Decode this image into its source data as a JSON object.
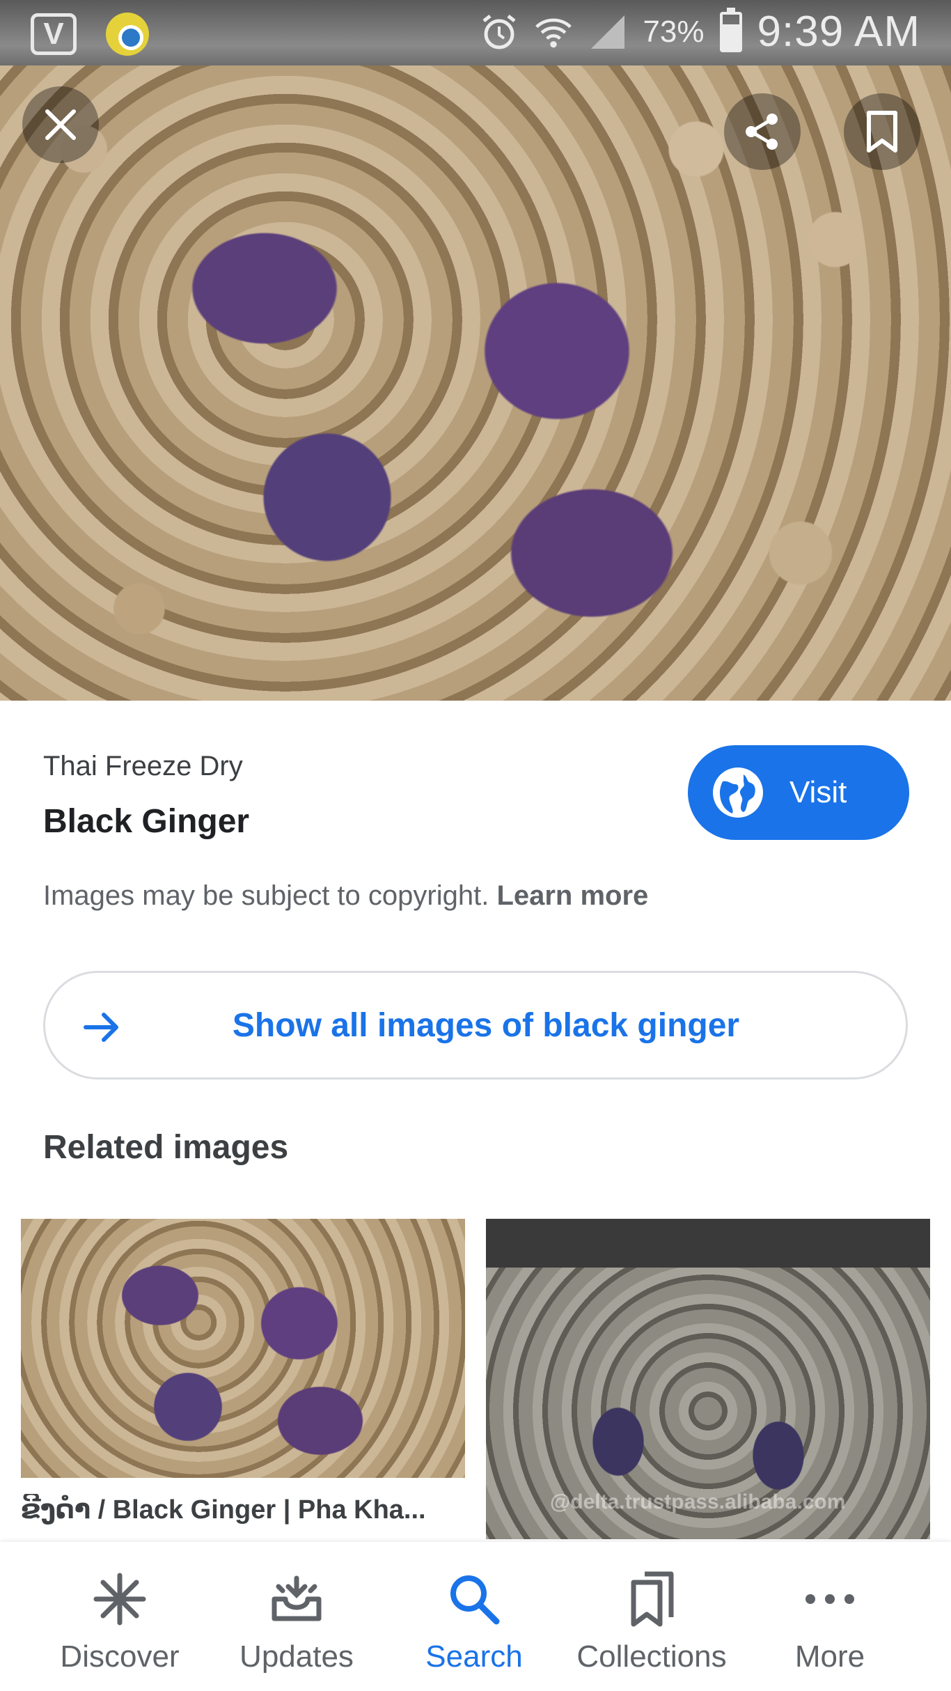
{
  "status_bar": {
    "battery_percent": "73%",
    "time": "9:39 AM"
  },
  "image_viewer": {
    "close_icon": "close-icon",
    "share_icon": "share-icon",
    "bookmark_icon": "bookmark-icon"
  },
  "result": {
    "source": "Thai Freeze Dry",
    "title": "Black Ginger",
    "visit_label": "Visit",
    "copyright_text": "Images may be subject to copyright.",
    "learn_more": "Learn more"
  },
  "show_all": {
    "label": "Show all images of black ginger"
  },
  "related": {
    "heading": "Related images",
    "items": [
      {
        "caption": "ຂີງດໍາ / Black Ginger | Pha Kha..."
      },
      {
        "watermark": "@delta.trustpass.alibaba.com"
      }
    ]
  },
  "bottom_nav": {
    "active": "Search",
    "items": [
      {
        "label": "Discover",
        "icon": "asterisk-icon"
      },
      {
        "label": "Updates",
        "icon": "updates-tray-icon"
      },
      {
        "label": "Search",
        "icon": "search-icon"
      },
      {
        "label": "Collections",
        "icon": "collections-icon"
      },
      {
        "label": "More",
        "icon": "more-dots-icon"
      }
    ]
  },
  "colors": {
    "accent": "#1a73e8",
    "text_primary": "#202124",
    "text_secondary": "#5f6368"
  }
}
